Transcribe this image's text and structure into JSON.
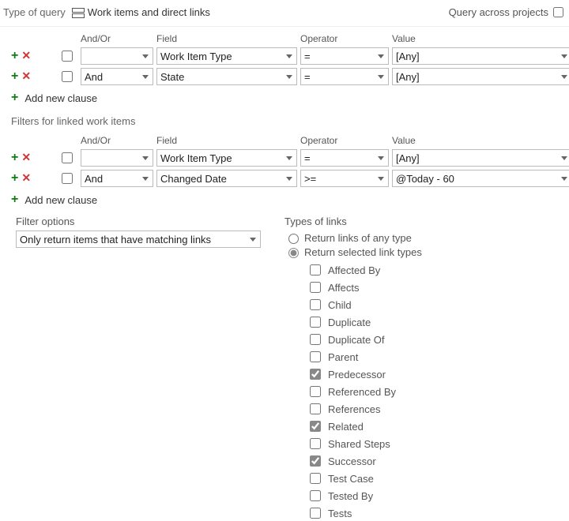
{
  "topbar": {
    "type_of_query_label": "Type of query",
    "query_type_value": "Work items and direct links",
    "query_across_label": "Query across projects",
    "query_across_checked": false
  },
  "headers": {
    "and_or": "And/Or",
    "field": "Field",
    "operator": "Operator",
    "value": "Value"
  },
  "top_clauses": [
    {
      "checked": false,
      "and_or": "",
      "field": "Work Item Type",
      "operator": "=",
      "value": "[Any]"
    },
    {
      "checked": false,
      "and_or": "And",
      "field": "State",
      "operator": "=",
      "value": "[Any]"
    }
  ],
  "add_new_clause_label": "Add new clause",
  "linked_section_title": "Filters for linked work items",
  "linked_clauses": [
    {
      "checked": false,
      "and_or": "",
      "field": "Work Item Type",
      "operator": "=",
      "value": "[Any]"
    },
    {
      "checked": false,
      "and_or": "And",
      "field": "Changed Date",
      "operator": ">=",
      "value": "@Today - 60"
    }
  ],
  "filter_options": {
    "label": "Filter options",
    "value": "Only return items that have matching links"
  },
  "link_types": {
    "label": "Types of links",
    "radio_any": "Return links of any type",
    "radio_selected": "Return selected link types",
    "radio_value": "selected",
    "options": [
      {
        "label": "Affected By",
        "checked": false
      },
      {
        "label": "Affects",
        "checked": false
      },
      {
        "label": "Child",
        "checked": false
      },
      {
        "label": "Duplicate",
        "checked": false
      },
      {
        "label": "Duplicate Of",
        "checked": false
      },
      {
        "label": "Parent",
        "checked": false
      },
      {
        "label": "Predecessor",
        "checked": true
      },
      {
        "label": "Referenced By",
        "checked": false
      },
      {
        "label": "References",
        "checked": false
      },
      {
        "label": "Related",
        "checked": true
      },
      {
        "label": "Shared Steps",
        "checked": false
      },
      {
        "label": "Successor",
        "checked": true
      },
      {
        "label": "Test Case",
        "checked": false
      },
      {
        "label": "Tested By",
        "checked": false
      },
      {
        "label": "Tests",
        "checked": false
      }
    ]
  }
}
